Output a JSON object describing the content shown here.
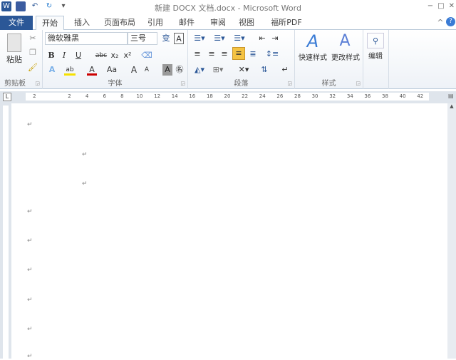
{
  "titlebar": {
    "title": "新建 DOCX 文档.docx - Microsoft Word",
    "icons": [
      "word-logo",
      "save-icon",
      "undo-icon",
      "redo-icon",
      "customize-qat-icon"
    ],
    "window_buttons": [
      "−",
      "□",
      "✕"
    ]
  },
  "tabs": [
    {
      "label": "文件"
    },
    {
      "label": "开始"
    },
    {
      "label": "插入"
    },
    {
      "label": "页面布局"
    },
    {
      "label": "引用"
    },
    {
      "label": "邮件"
    },
    {
      "label": "审阅"
    },
    {
      "label": "视图"
    },
    {
      "label": "福昕PDF"
    }
  ],
  "ribbon": {
    "clipboard": {
      "paste": "粘贴",
      "label": "剪贴板"
    },
    "font": {
      "name": "微软雅黑",
      "size": "三号",
      "label": "字体",
      "bold": "B",
      "italic": "I",
      "underline": "U",
      "strike": "abc",
      "sub": "x₂",
      "sup": "x²",
      "color": "A",
      "case": "Aa",
      "grow": "A",
      "shrink": "A"
    },
    "paragraph": {
      "label": "段落"
    },
    "styles": {
      "quick": "快速样式",
      "change": "更改样式",
      "label": "样式"
    },
    "editing": {
      "label": "编辑"
    }
  },
  "ruler": {
    "ticks": [
      "2",
      "",
      "2",
      "4",
      "6",
      "8",
      "10",
      "12",
      "14",
      "16",
      "18",
      "20",
      "22",
      "24",
      "26",
      "28",
      "30",
      "32",
      "34",
      "36",
      "38",
      "40",
      "42"
    ]
  },
  "document": {
    "paragraph_mark": "↵"
  },
  "colors": {
    "file_tab": "#2b5797",
    "accent": "#f5c342"
  }
}
